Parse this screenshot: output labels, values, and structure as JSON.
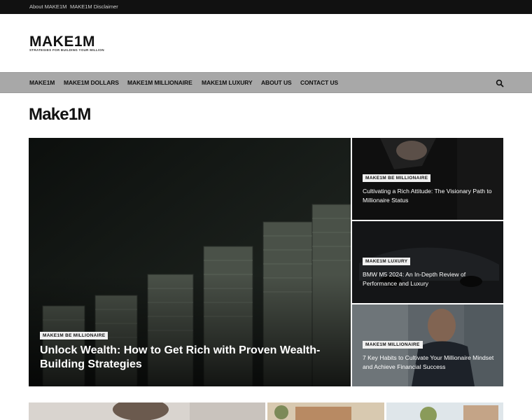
{
  "topbar": {
    "links": [
      "About MAKE1M",
      "MAKE1M Disclaimer"
    ]
  },
  "logo": {
    "word": "MAKE1M",
    "tagline": "STRATEGIES FOR BUILDING YOUR MILLION"
  },
  "nav": {
    "items": [
      "MAKE1M",
      "MAKE1M DOLLARS",
      "MAKE1M MILLIONAIRE",
      "MAKE1M LUXURY",
      "ABOUT US",
      "CONTACT US"
    ]
  },
  "page": {
    "title": "Make1M"
  },
  "featured": {
    "category": "MAKE1M BE MILLIONAIRE",
    "title": "Unlock Wealth: How to Get Rich with Proven Wealth-Building Strategies"
  },
  "side_posts": [
    {
      "category": "MAKE1M BE MILLIONAIRE",
      "title": "Cultivating a Rich Attitude: The Visionary Path to Millionaire Status"
    },
    {
      "category": "MAKE1M LUXURY",
      "title": "BMW M5 2024: An In-Depth Review of Performance and Luxury"
    },
    {
      "category": "MAKE1M MILLIONAIRE",
      "title": "7 Key Habits to Cultivate Your Millionaire Mindset and Achieve Financial Success"
    }
  ],
  "colors": {
    "topbar": "#111111",
    "navbar": "#a8a8a8",
    "badge_bg": "#f1f1f1",
    "card_text": "#ffffff"
  }
}
